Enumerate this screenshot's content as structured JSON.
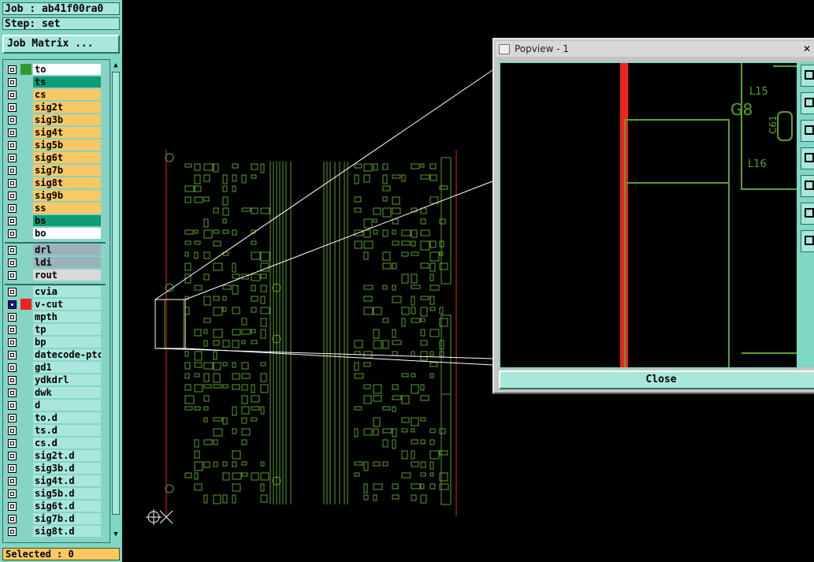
{
  "job_label": "Job : ab41f00ra0",
  "step_label": "Step: set",
  "job_matrix_label": "Job Matrix ...",
  "selected_label": "Selected : 0",
  "layers": [
    {
      "name": "to",
      "swatch": "#2f9a2f",
      "bg": "#ffffff",
      "active": false
    },
    {
      "name": "ts",
      "swatch": "#0f9c77",
      "bg": "#0f9c77",
      "active": false
    },
    {
      "name": "cs",
      "swatch": "#f9c864",
      "bg": "#f9c864",
      "active": false
    },
    {
      "name": "sig2t",
      "swatch": "#f9c864",
      "bg": "#f9c864",
      "active": false
    },
    {
      "name": "sig3b",
      "swatch": "#f9c864",
      "bg": "#f9c864",
      "active": false
    },
    {
      "name": "sig4t",
      "swatch": "#f9c864",
      "bg": "#f9c864",
      "active": false
    },
    {
      "name": "sig5b",
      "swatch": "#f9c864",
      "bg": "#f9c864",
      "active": false
    },
    {
      "name": "sig6t",
      "swatch": "#f9c864",
      "bg": "#f9c864",
      "active": false
    },
    {
      "name": "sig7b",
      "swatch": "#f9c864",
      "bg": "#f9c864",
      "active": false
    },
    {
      "name": "sig8t",
      "swatch": "#f9c864",
      "bg": "#f9c864",
      "active": false
    },
    {
      "name": "sig9b",
      "swatch": "#f9c864",
      "bg": "#f9c864",
      "active": false
    },
    {
      "name": "ss",
      "swatch": "#f9c864",
      "bg": "#f9c864",
      "active": false
    },
    {
      "name": "bs",
      "swatch": "#0f9c77",
      "bg": "#0f9c77",
      "active": false
    },
    {
      "name": "bo",
      "swatch": "#ffffff",
      "bg": "#ffffff",
      "active": false
    },
    {
      "name": "drl",
      "swatch": "#9bb2bd",
      "bg": "#9bb2bd",
      "active": false
    },
    {
      "name": "ldi",
      "swatch": "#9bb2bd",
      "bg": "#9bb2bd",
      "active": false
    },
    {
      "name": "rout",
      "swatch": "#d9d9d9",
      "bg": "#d9d9d9",
      "active": false
    },
    {
      "name": "cvia",
      "swatch": "#a9e6dc",
      "bg": "#a9e6dc",
      "active": false
    },
    {
      "name": "v-cut",
      "swatch": "#ee2222",
      "bg": "#a9e6dc",
      "active": true
    },
    {
      "name": "mpth",
      "swatch": "#a9e6dc",
      "bg": "#a9e6dc",
      "active": false
    },
    {
      "name": "tp",
      "swatch": "#a9e6dc",
      "bg": "#a9e6dc",
      "active": false
    },
    {
      "name": "bp",
      "swatch": "#a9e6dc",
      "bg": "#a9e6dc",
      "active": false
    },
    {
      "name": "datecode-ptc",
      "swatch": "#a9e6dc",
      "bg": "#a9e6dc",
      "active": false
    },
    {
      "name": "gd1",
      "swatch": "#a9e6dc",
      "bg": "#a9e6dc",
      "active": false
    },
    {
      "name": "ydkdrl",
      "swatch": "#a9e6dc",
      "bg": "#a9e6dc",
      "active": false
    },
    {
      "name": "dwk",
      "swatch": "#a9e6dc",
      "bg": "#a9e6dc",
      "active": false
    },
    {
      "name": "d",
      "swatch": "#a9e6dc",
      "bg": "#a9e6dc",
      "active": false
    },
    {
      "name": "to.d",
      "swatch": "#a9e6dc",
      "bg": "#a9e6dc",
      "active": false
    },
    {
      "name": "ts.d",
      "swatch": "#a9e6dc",
      "bg": "#a9e6dc",
      "active": false
    },
    {
      "name": "cs.d",
      "swatch": "#a9e6dc",
      "bg": "#a9e6dc",
      "active": false
    },
    {
      "name": "sig2t.d",
      "swatch": "#a9e6dc",
      "bg": "#a9e6dc",
      "active": false
    },
    {
      "name": "sig3b.d",
      "swatch": "#a9e6dc",
      "bg": "#a9e6dc",
      "active": false
    },
    {
      "name": "sig4t.d",
      "swatch": "#a9e6dc",
      "bg": "#a9e6dc",
      "active": false
    },
    {
      "name": "sig5b.d",
      "swatch": "#a9e6dc",
      "bg": "#a9e6dc",
      "active": false
    },
    {
      "name": "sig6t.d",
      "swatch": "#a9e6dc",
      "bg": "#a9e6dc",
      "active": false
    },
    {
      "name": "sig7b.d",
      "swatch": "#a9e6dc",
      "bg": "#a9e6dc",
      "active": false
    },
    {
      "name": "sig8t.d",
      "swatch": "#a9e6dc",
      "bg": "#a9e6dc",
      "active": false
    }
  ],
  "popview": {
    "title": "Popview - 1",
    "close_label": "Close",
    "close_x": "✕",
    "labels": [
      "L15",
      "G8",
      "C61",
      "L16"
    ],
    "tools": [
      "zoom-fit-icon",
      "zoom-in-icon",
      "zoom-out-icon",
      "pan-left-icon",
      "pan-right-icon",
      "expand-icon",
      "shrink-icon"
    ]
  },
  "colors": {
    "trace": "#5aa02c",
    "vcut": "#ee2222",
    "panel": "#7fd7c6"
  }
}
